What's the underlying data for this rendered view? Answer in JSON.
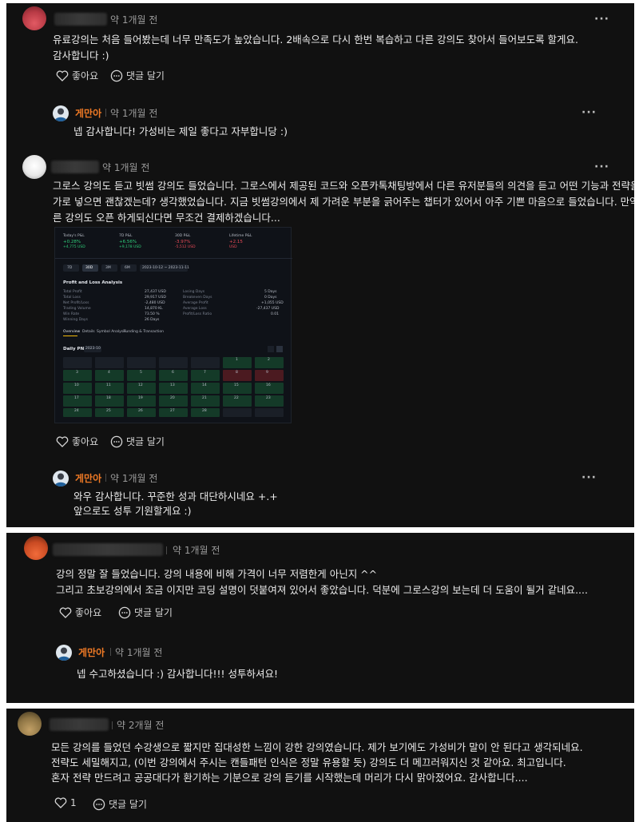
{
  "reply_author": "게만아",
  "actions": {
    "like": "좋아요",
    "reply": "댓글 달기"
  },
  "more": "···",
  "comments": [
    {
      "time": "약 1개월 전",
      "lines": [
        "유료강의는 처음 들어봤는데 너무 만족도가 높았습니다. 2배속으로 다시 한번 복습하고 다른 강의도 찾아서 들어보도록 할게요.",
        "감사합니다 :)"
      ],
      "reply": {
        "time": "약 1개월 전",
        "lines": [
          "넵 감사합니다! 가성비는 제일 좋다고 자부합니당 :)"
        ]
      }
    },
    {
      "time": "약 1개월 전",
      "lines": [
        "그로스 강의도 듣고 빗썸 강의도 들었습니다. 그로스에서 제공된 코드와 오픈카톡채팅방에서 다른 유저분들의 의견을 듣고 어떤 기능과 전략을 추",
        "가로 넣으면 괜찮겠는데? 생각했었습니다. 지금 빗썸강의에서 제 가려운 부분을 긁어주는 챕터가 있어서 아주 기쁜 마음으로 들었습니다. 만약 다",
        "른 강의도 오픈 하게되신다면 무조건 결제하겠습니다..."
      ],
      "reply": {
        "time": "약 1개월 전",
        "lines": [
          "와우 감사합니다. 꾸준한 성과 대단하시네요 +.+",
          "앞으로도 성투 기원할게요 :)"
        ]
      }
    },
    {
      "time": "약 1개월 전",
      "lines": [
        "강의 정말 잘 들었습니다. 강의 내용에 비해 가격이 너무 저렴한게 아닌지 ^^",
        "그리고 초보강의에서 조금 이지만 코딩 설명이 덧붙여져 있어서 좋았습니다. 덕분에 그로스강의 보는데 더 도움이 될거 같네요...."
      ],
      "reply": {
        "time": "약 1개월 전",
        "lines": [
          "넵 수고하셨습니다 :) 감사합니다!!! 성투하셔요!"
        ]
      }
    },
    {
      "time": "약 2개월 전",
      "lines": [
        "모든 강의를 들었던 수강생으로 짧지만 집대성한 느낌이 강한 강의였습니다. 제가 보기에도 가성비가 말이 안 된다고 생각되네요.",
        "전략도 세밀해지고, (이번 강의에서 주시는 캔들패턴 인식은 정말 유용할 듯) 강의도 더 메끄러워지신 것 같아요. 최고입니다.",
        "혼자 전략 만드려고 공공대다가 환기하는 기분으로 강의 듣기를 시작했는데 머리가 다시 맑아졌어요. 감사합니다...."
      ],
      "like_count": "1"
    }
  ],
  "screenshot": {
    "stats": [
      {
        "label": "Today's P&L",
        "value": "+0.28%",
        "sub": "+4,775 USD"
      },
      {
        "label": "7D P&L",
        "value": "+6.56%",
        "sub": "+9,178 USD"
      },
      {
        "label": "30D P&L",
        "value": "-3.97%",
        "sub": "-5,512 USD"
      },
      {
        "label": "Lifetime P&L",
        "value": "+2.15",
        "sub": "USD"
      }
    ],
    "filters": [
      "7D",
      "30D",
      "3M",
      "6M"
    ],
    "date_range": "2023-10-12  ~  2023-11-11",
    "section_title": "Profit and Loss Analysis",
    "rows_left": [
      [
        "Total Profit",
        "27,437 USD"
      ],
      [
        "Total Loss",
        "29,917 USD"
      ],
      [
        "Net Profit/Loss",
        "-2,480 USD"
      ],
      [
        "Trading Volume",
        "14,870 KL"
      ],
      [
        "Win Rate",
        "73.50 %"
      ],
      [
        "Winning Days",
        "26 Days"
      ]
    ],
    "rows_right": [
      [
        "Losing Days",
        "5 Days"
      ],
      [
        "Breakeven Days",
        "0 Days"
      ],
      [
        "Average Profit",
        "+1,055 USD"
      ],
      [
        "Average Loss",
        "-27,437 USD"
      ],
      [
        "Profit/Loss Ratio",
        "0.01"
      ]
    ],
    "tabs": [
      "Overview",
      "Details",
      "Symbol Analysis",
      "Funding & Transaction"
    ],
    "daily_title": "Daily PNL",
    "month": "2023-10",
    "calendar_days": [
      "1",
      "2",
      "3",
      "4",
      "5",
      "6",
      "7",
      "8",
      "9",
      "10",
      "11",
      "12",
      "13",
      "14",
      "15",
      "16",
      "17",
      "18",
      "19",
      "20",
      "21",
      "22",
      "23",
      "24",
      "25",
      "26",
      "27",
      "28"
    ]
  }
}
